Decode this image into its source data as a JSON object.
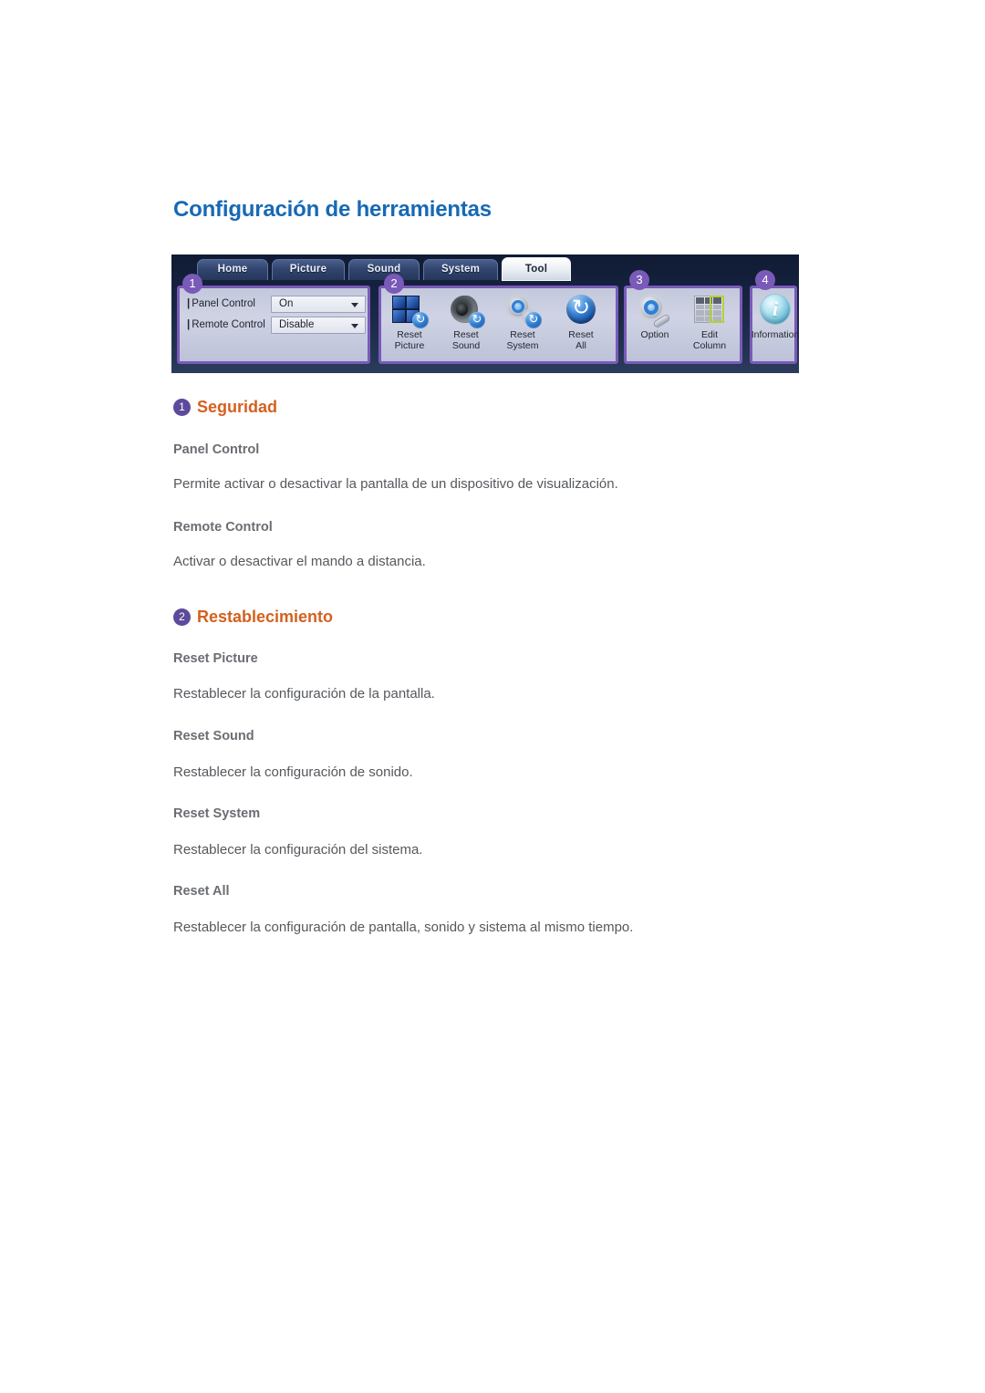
{
  "page": {
    "title": "Configuración de herramientas"
  },
  "figure": {
    "name": "tool-settings-toolbar-screenshot",
    "tabs": [
      {
        "label": "Home",
        "active": false
      },
      {
        "label": "Picture",
        "active": false
      },
      {
        "label": "Sound",
        "active": false
      },
      {
        "label": "System",
        "active": false
      },
      {
        "label": "Tool",
        "active": true
      }
    ],
    "callouts": [
      "1",
      "2",
      "3",
      "4"
    ],
    "group1": {
      "settings": [
        {
          "label": "Panel Control",
          "value": "On"
        },
        {
          "label": "Remote Control",
          "value": "Disable"
        }
      ]
    },
    "group2": {
      "buttons": [
        {
          "caption": "Reset\nPicture",
          "icon": "reset-picture-icon"
        },
        {
          "caption": "Reset\nSound",
          "icon": "reset-sound-icon"
        },
        {
          "caption": "Reset\nSystem",
          "icon": "reset-system-icon"
        },
        {
          "caption": "Reset\nAll",
          "icon": "reset-all-icon"
        }
      ]
    },
    "group3": {
      "buttons": [
        {
          "caption": "Option",
          "icon": "option-gear-wrench-icon"
        },
        {
          "caption": "Edit\nColumn",
          "icon": "edit-column-icon"
        }
      ]
    },
    "group4": {
      "buttons": [
        {
          "caption": "Information",
          "icon": "information-icon"
        }
      ]
    }
  },
  "sections": [
    {
      "number": "1",
      "heading": "Seguridad",
      "items": [
        {
          "term": "Panel Control",
          "description": "Permite activar o desactivar la pantalla de un dispositivo de visualización."
        },
        {
          "term": "Remote Control",
          "description": "Activar o desactivar el mando a distancia."
        }
      ]
    },
    {
      "number": "2",
      "heading": "Restablecimiento",
      "items": [
        {
          "term": "Reset Picture",
          "description": "Restablecer la configuración de la pantalla."
        },
        {
          "term": "Reset Sound",
          "description": "Restablecer la configuración de sonido."
        },
        {
          "term": "Reset System",
          "description": "Restablecer la configuración del sistema."
        },
        {
          "term": "Reset All",
          "description": "Restablecer la configuración de pantalla, sonido y sistema al mismo tiempo."
        }
      ]
    }
  ],
  "colors": {
    "title_blue": "#1769b5",
    "heading_orange": "#d4601f",
    "badge_purple": "#5d4a9c",
    "callout_purple": "#7a5ab8",
    "subhead_gray": "#6a6d72",
    "body_gray": "#55585d"
  }
}
